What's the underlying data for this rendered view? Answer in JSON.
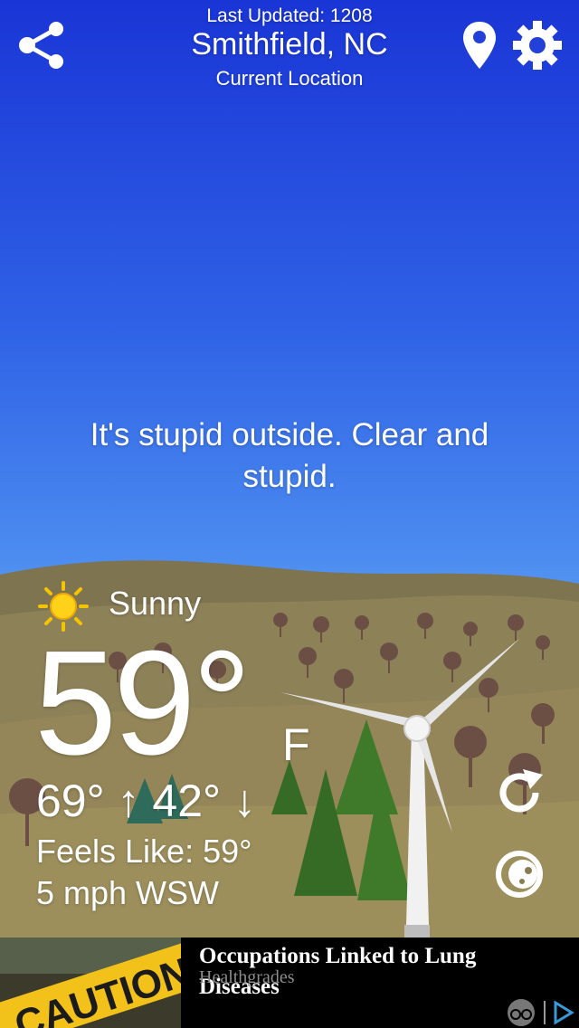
{
  "header": {
    "last_updated": "Last Updated: 1208",
    "city": "Smithfield, NC",
    "location_label": "Current Location"
  },
  "icons": {
    "share": "share-icon",
    "location": "location-pin-icon",
    "settings": "gear-icon",
    "condition": "sun-icon",
    "refresh": "refresh-icon",
    "theme": "moon-icon",
    "ad_choices": "adchoices-icon"
  },
  "forecast": {
    "quip": "It's stupid outside. Clear and stupid.",
    "condition": "Sunny",
    "temperature": "59°",
    "unit": "F",
    "high_low": "69° ↑ 42° ↓",
    "feels_like": "Feels Like: 59°",
    "wind": "5 mph WSW"
  },
  "ad": {
    "image_text": "CAUTION",
    "title": "Occupations Linked to Lung Diseases",
    "source": "Healthgrades"
  },
  "colors": {
    "sky_top": "#1a35d6",
    "sky_bottom": "#6cb3f6",
    "hills": "#8a7a52",
    "tree_green": "#3f7a2a",
    "ad_background": "#000000",
    "caution_yellow": "#f2c21b"
  }
}
